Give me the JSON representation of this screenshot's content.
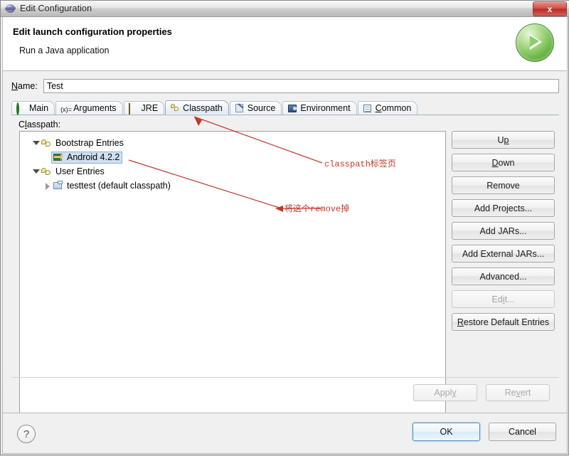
{
  "window": {
    "title": "Edit Configuration",
    "icon": "eclipse-sphere-icon",
    "close_label": "x"
  },
  "header": {
    "title": "Edit launch configuration properties",
    "subtitle": "Run a Java application",
    "badge_icon": "run-play-icon"
  },
  "name_field": {
    "label": "Name:",
    "label_mnemonic": "N",
    "value": "Test",
    "placeholder": ""
  },
  "tabs": [
    {
      "label": "Main",
      "icon": "main-circle-icon",
      "active": false
    },
    {
      "label": "Arguments",
      "icon": "arguments-xy-icon",
      "active": false
    },
    {
      "label": "JRE",
      "icon": "jre-book-icon",
      "active": false
    },
    {
      "label": "Classpath",
      "icon": "classpath-jar-icon",
      "active": true
    },
    {
      "label": "Source",
      "icon": "source-pencil-icon",
      "active": false
    },
    {
      "label": "Environment",
      "icon": "environment-icon",
      "active": false
    },
    {
      "label": "Common",
      "icon": "common-doc-icon",
      "active": false
    }
  ],
  "classpath": {
    "label": "Classpath:",
    "tree": [
      {
        "label": "Bootstrap Entries",
        "icon": "library-icon",
        "level": 0,
        "twisty": "open",
        "selected": false
      },
      {
        "label": "Android 4.2.2",
        "icon": "jre-book-icon",
        "level": 1,
        "twisty": "none",
        "selected": true
      },
      {
        "label": "User Entries",
        "icon": "library-icon",
        "level": 0,
        "twisty": "open",
        "selected": false
      },
      {
        "label": "testtest (default classpath)",
        "icon": "project-folder-icon",
        "level": 1,
        "twisty": "closed",
        "selected": false
      }
    ]
  },
  "side_buttons": [
    {
      "label": "Up",
      "mnemonic": "p",
      "disabled": false
    },
    {
      "label": "Down",
      "mnemonic": "D",
      "disabled": false
    },
    {
      "label": "Remove",
      "mnemonic": "",
      "disabled": false
    },
    {
      "label": "Add Projects...",
      "mnemonic": "",
      "disabled": false
    },
    {
      "label": "Add JARs...",
      "mnemonic": "",
      "disabled": false
    },
    {
      "label": "Add External JARs...",
      "mnemonic": "",
      "disabled": false
    },
    {
      "label": "Advanced...",
      "mnemonic": "",
      "disabled": false
    },
    {
      "label": "Edit...",
      "mnemonic": "i",
      "disabled": true
    },
    {
      "label": "Restore Default Entries",
      "mnemonic": "R",
      "disabled": false
    }
  ],
  "apply_revert": {
    "apply_label": "Apply",
    "apply_disabled": true,
    "revert_label": "Revert",
    "revert_disabled": true
  },
  "footer": {
    "help_label": "?",
    "ok_label": "OK",
    "cancel_label": "Cancel"
  },
  "annotations": {
    "color": "#c0392b",
    "classpath_note": "classpath标签页",
    "remove_note": "将这个remove掉"
  }
}
